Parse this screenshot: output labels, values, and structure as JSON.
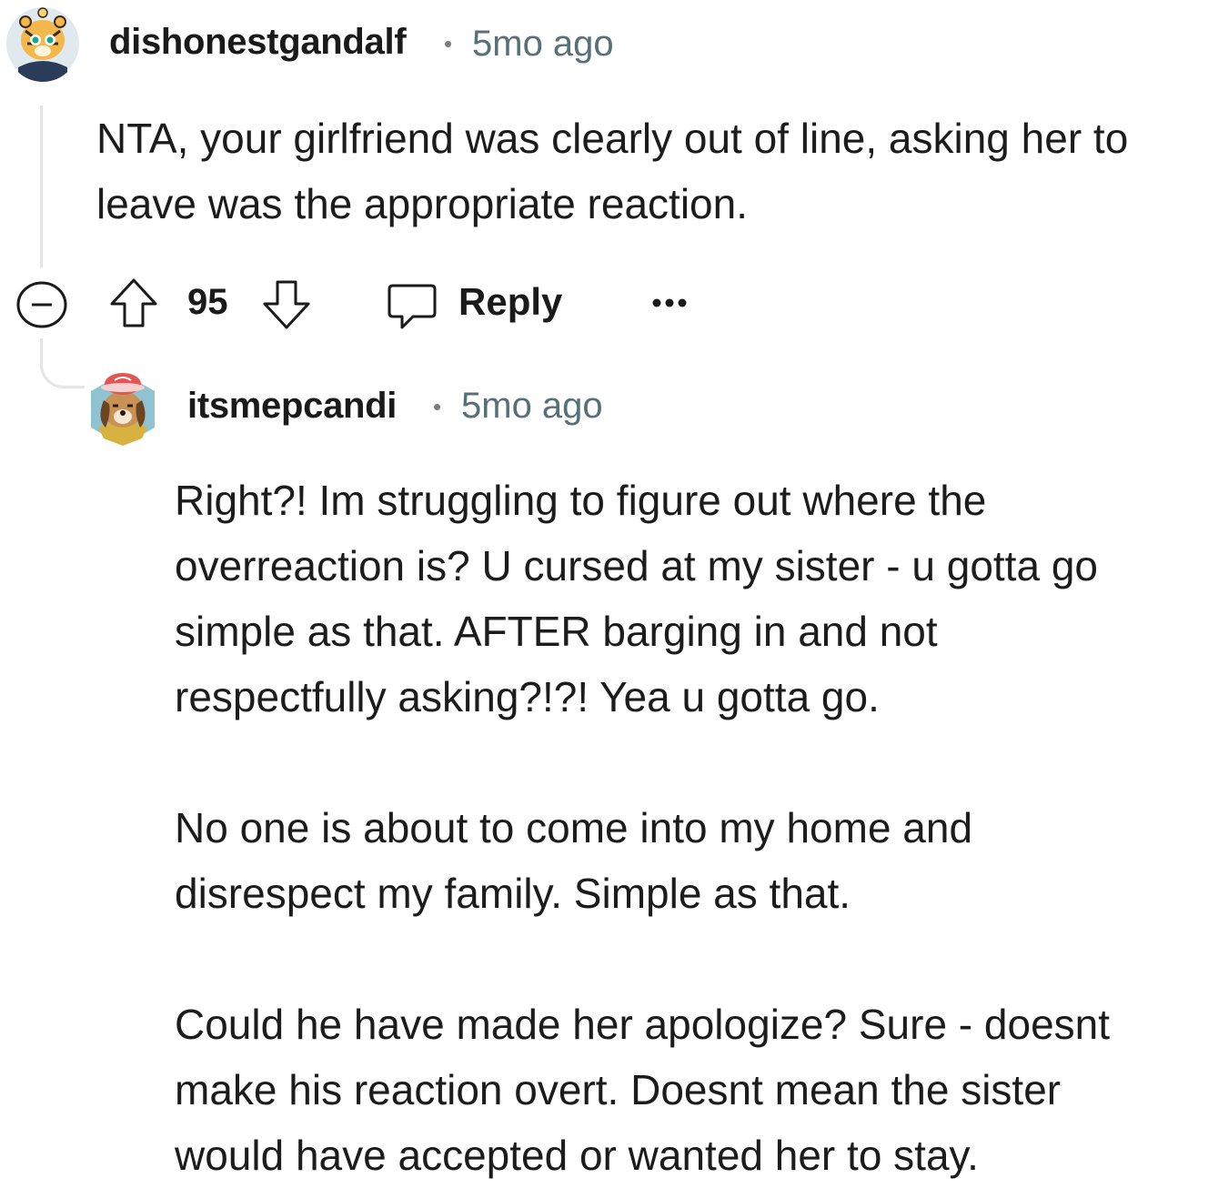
{
  "comment1": {
    "username": "dishonestgandalf",
    "separator": "•",
    "time": "5mo ago",
    "body": "NTA, your girlfriend was clearly out of line, asking her to\nleave was the appropriate reaction.",
    "avatar_icon": "tiger-avatar-icon",
    "actions": {
      "collapse_icon": "minus-circle-icon",
      "upvote_icon": "arrow-up-icon",
      "score": "95",
      "downvote_icon": "arrow-down-icon",
      "reply_icon": "speech-bubble-icon",
      "reply_label": "Reply",
      "more_icon": "ellipsis-icon"
    }
  },
  "comment2": {
    "username": "itsmepcandi",
    "separator": "•",
    "time": "5mo ago",
    "avatar_icon": "dog-avatar-icon",
    "body": "Right?! Im struggling to figure out where the\noverreaction is? U cursed at my sister - u gotta go\nsimple as that. AFTER barging in and not\nrespectfully asking?!?! Yea u gotta go.\n\nNo one is about to come into my home and\ndisrespect my family. Simple as that.\n\nCould he have made her apologize? Sure - doesnt\nmake his reaction overt. Doesnt mean the sister\nwould have accepted or wanted her to stay."
  },
  "colors": {
    "thread_line": "#e5e5e5",
    "meta_text": "#576f76",
    "icon_stroke": "#1a1a1b"
  }
}
